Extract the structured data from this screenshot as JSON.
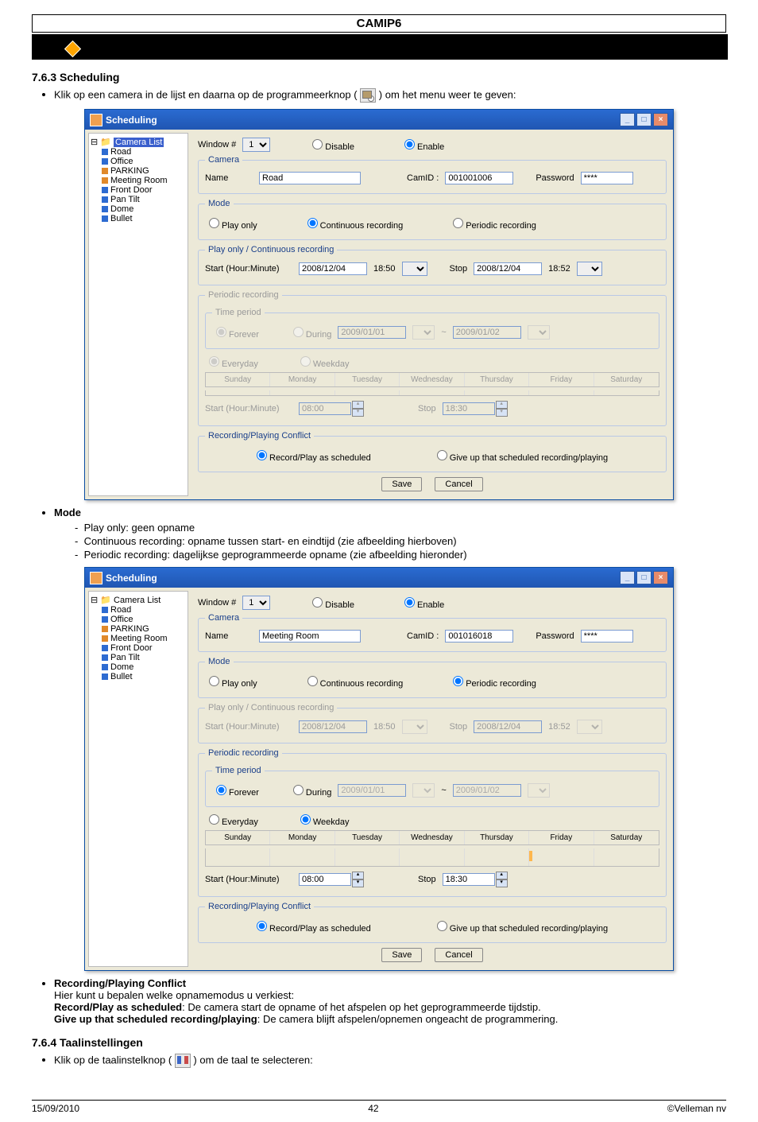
{
  "header": {
    "title": "CAMIP6"
  },
  "s763": {
    "heading": "7.6.3 Scheduling",
    "bullet1_pre": "Klik op een camera in de lijst en daarna op de programmeerknop (",
    "bullet1_post": ") om het menu weer te geven:"
  },
  "dlg1": {
    "title": "Scheduling",
    "tree_root": "Camera List",
    "tree_items": [
      "Road",
      "Office",
      "PARKING",
      "Meeting Room",
      "Front Door",
      "Pan Tilt",
      "Dome",
      "Bullet"
    ],
    "window_lbl": "Window #",
    "window_val": "1",
    "disable": "Disable",
    "enable": "Enable",
    "camera_legend": "Camera",
    "name_lbl": "Name",
    "name_val": "Road",
    "camid_lbl": "CamID :",
    "camid_val": "001001006",
    "pass_lbl": "Password",
    "pass_val": "****",
    "mode_legend": "Mode",
    "play_only": "Play only",
    "continuous": "Continuous recording",
    "periodic": "Periodic recording",
    "pocr_legend": "Play only / Continuous recording",
    "start_lbl": "Start (Hour:Minute)",
    "start_date": "2008/12/04",
    "start_time": "18:50",
    "stop_lbl": "Stop",
    "stop_date": "2008/12/04",
    "stop_time": "18:52",
    "per_legend": "Periodic recording",
    "tp_legend": "Time period",
    "forever": "Forever",
    "during": "During",
    "d1": "2009/01/01",
    "d2": "2009/01/02",
    "everyday": "Everyday",
    "weekday": "Weekday",
    "days": [
      "Sunday",
      "Monday",
      "Tuesday",
      "Wednesday",
      "Thursday",
      "Friday",
      "Saturday"
    ],
    "start2": "Start (Hour:Minute)",
    "start2_val": "08:00",
    "stop2": "Stop",
    "stop2_val": "18:30",
    "conflict_legend": "Recording/Playing Conflict",
    "rec_sched": "Record/Play as scheduled",
    "giveup": "Give up that scheduled recording/playing",
    "save": "Save",
    "cancel": "Cancel"
  },
  "mode_section": {
    "heading": "Mode",
    "l1": "Play only: geen opname",
    "l2": "Continuous recording: opname tussen start- en eindtijd (zie afbeelding hierboven)",
    "l3": "Periodic recording: dagelijkse geprogrammeerde opname (zie afbeelding hieronder)"
  },
  "dlg2": {
    "title": "Scheduling",
    "tree_items": [
      "Road",
      "Office",
      "PARKING",
      "Meeting Room",
      "Front Door",
      "Pan Tilt",
      "Dome",
      "Bullet"
    ],
    "name_val": "Meeting Room",
    "camid_val": "001016018",
    "pass_val": "****",
    "start_date": "2008/12/04",
    "start_time": "18:50",
    "stop_date": "2008/12/04",
    "stop_time": "18:52",
    "d1": "2009/01/01",
    "d2": "2009/01/02",
    "start2_val": "08:00",
    "stop2_val": "18:30"
  },
  "rpc": {
    "heading": "Recording/Playing Conflict",
    "l1": "Hier kunt u bepalen welke opnamemodus u verkiest:",
    "l2a": "Record/Play as scheduled",
    "l2b": ": De camera start de opname of het afspelen op het geprogrammeerde tijdstip.",
    "l3a": "Give up that scheduled recording/playing",
    "l3b": ": De camera blijft afspelen/opnemen ongeacht de programmering."
  },
  "s764": {
    "heading": "7.6.4 Taalinstellingen",
    "pre": "Klik op de taalinstelknop (",
    "post": ") om de taal te selecteren:"
  },
  "footer": {
    "left": "15/09/2010",
    "center": "42",
    "right": "©Velleman nv"
  }
}
